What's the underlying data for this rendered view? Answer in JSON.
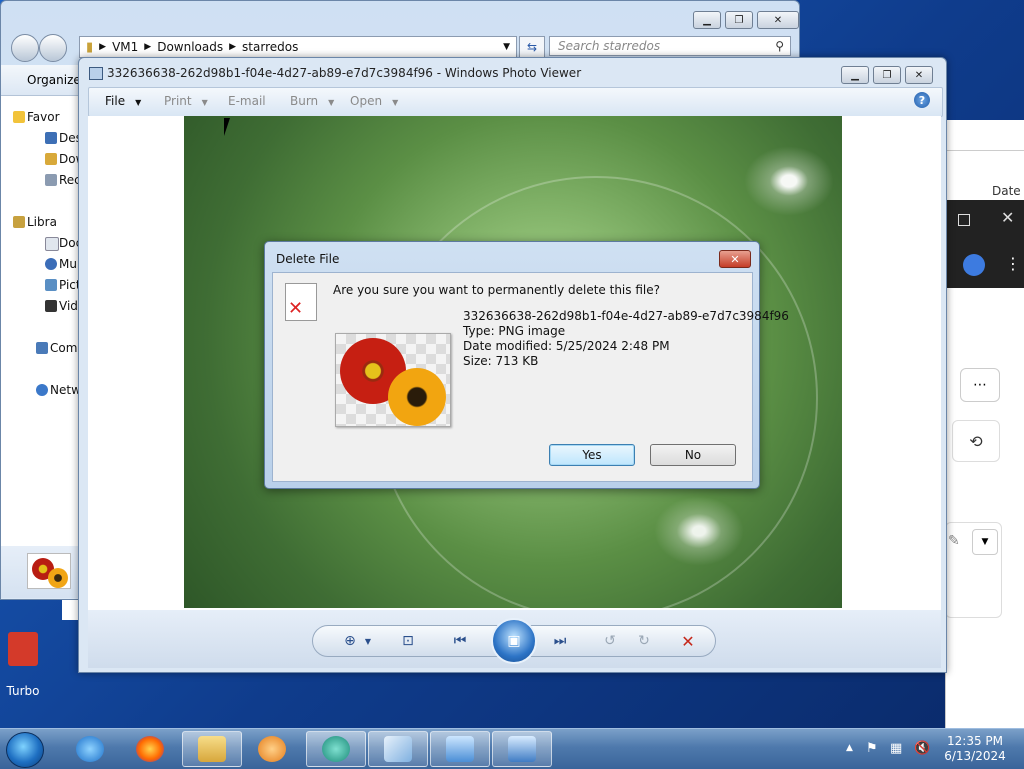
{
  "explorer": {
    "breadcrumb": [
      "VM1",
      "Downloads",
      "starredos"
    ],
    "search_placeholder": "Search starredos",
    "toolbar_organize": "Organize",
    "nav_items": [
      "Favor",
      "Des",
      "Dow",
      "Rec",
      "Libra",
      "Doc",
      "Mu",
      "Pict",
      "Vid",
      "Comp",
      "Netw"
    ]
  },
  "background_app": {
    "column_header": "Date r"
  },
  "desktop": {
    "shortcut_label": "Turbo"
  },
  "viewer": {
    "title": "332636638-262d98b1-f04e-4d27-ab89-e7d7c3984f96 - Windows Photo Viewer",
    "menu": {
      "file": "File",
      "print": "Print",
      "email": "E-mail",
      "burn": "Burn",
      "open": "Open"
    }
  },
  "dialog": {
    "title": "Delete File",
    "question": "Are you sure you want to permanently delete this file?",
    "filename": "332636638-262d98b1-f04e-4d27-ab89-e7d7c3984f96",
    "type": "Type: PNG image",
    "date_modified": "Date modified: 5/25/2024 2:48 PM",
    "size": "Size: 713 KB",
    "yes": "Yes",
    "no": "No"
  },
  "taskbar": {
    "time": "12:35 PM",
    "date": "6/13/2024"
  },
  "colors": {
    "accent": "#3c7fb1",
    "close_red": "#c53d27",
    "taskbar": "#4e79ac"
  }
}
